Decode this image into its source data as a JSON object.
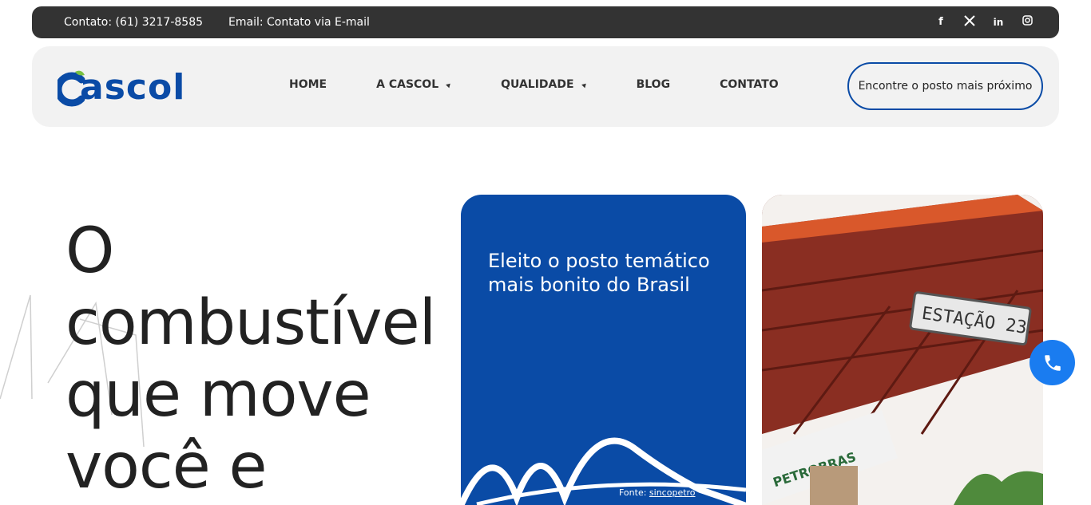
{
  "topbar": {
    "contact": "Contato: (61) 3217-8585",
    "email": "Email: Contato via E-mail",
    "socials": [
      "facebook-icon",
      "x-icon",
      "linkedin-icon",
      "instagram-icon"
    ]
  },
  "logo": {
    "text": "ascol",
    "brand_color": "#0a4ba6",
    "accent_color": "#7ac142"
  },
  "menu": {
    "home": "HOME",
    "cascol": "A CASCOL",
    "qualidade": "QUALIDADE",
    "blog": "BLOG",
    "contato": "CONTATO"
  },
  "cta": {
    "label": "Encontre o posto mais próximo"
  },
  "hero": {
    "line1": "O",
    "line2": "combustível",
    "line3": "que move",
    "line4": "você e"
  },
  "blue_card": {
    "headline": "Eleito o posto temático mais bonito do Brasil",
    "source_prefix": "Fonte: ",
    "source_link": "sincopetro"
  },
  "photo_card": {
    "sign_text": "ESTAÇÃO 23",
    "brand_text": "PETROBRAS"
  },
  "colors": {
    "topbar": "#333333",
    "navbar": "#f2f2f2",
    "primary": "#0a4ba6",
    "phone": "#1a7cf0"
  }
}
